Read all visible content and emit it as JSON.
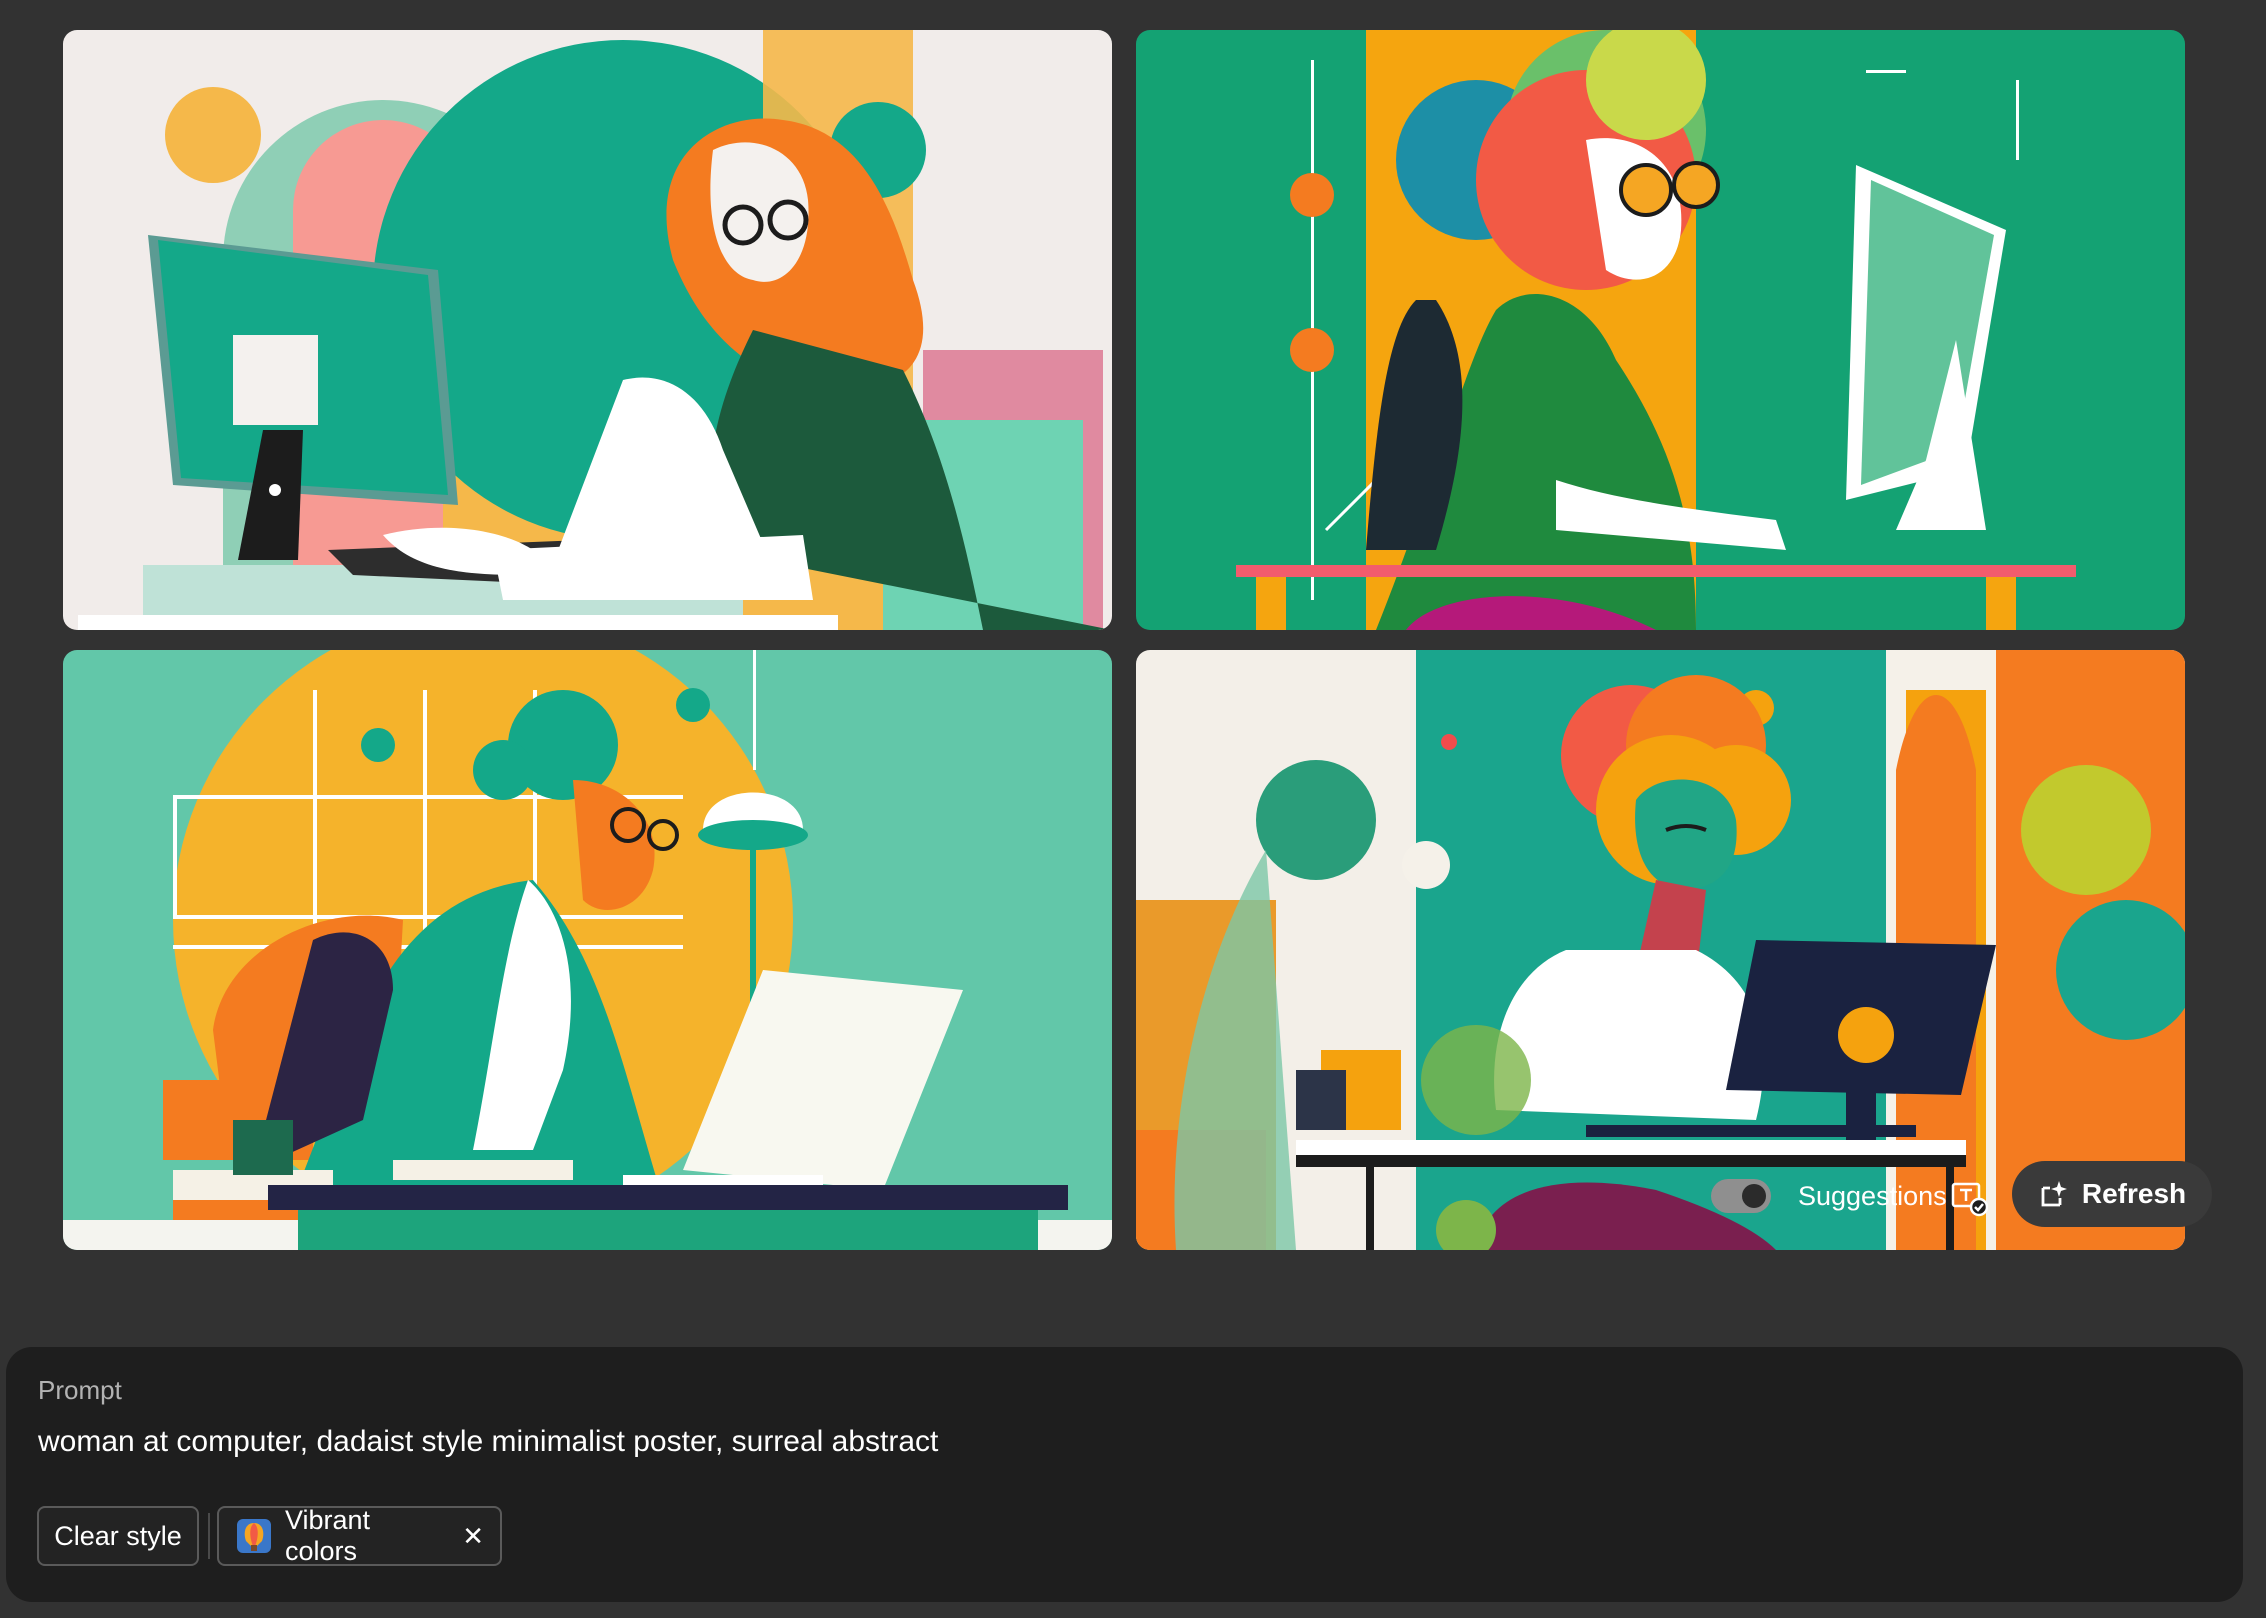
{
  "images": [
    {
      "id_label": "image-1"
    },
    {
      "id_label": "image-2"
    },
    {
      "id_label": "image-3"
    },
    {
      "id_label": "image-4"
    }
  ],
  "prompt": {
    "label": "Prompt",
    "text": "woman at computer, dadaist style minimalist poster, surreal abstract"
  },
  "styles": {
    "clear_label": "Clear style",
    "active_style_label": "Vibrant colors",
    "remove_icon": "close-icon"
  },
  "suggestions": {
    "label": "Suggestions",
    "enabled": true
  },
  "refresh": {
    "label": "Refresh",
    "icon": "refresh-sparkle-icon"
  },
  "colors": {
    "background": "#323232",
    "panel": "#1e1e1e",
    "teal": "#14a889",
    "orange": "#f47b20",
    "amber": "#f5a623"
  }
}
